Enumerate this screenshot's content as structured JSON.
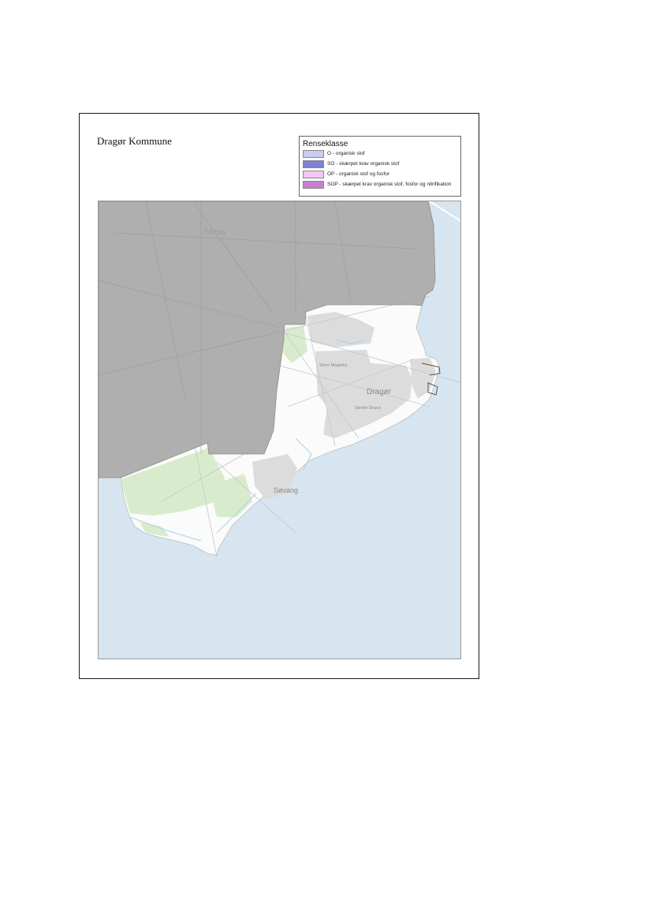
{
  "map": {
    "title": "Dragør Kommune",
    "legend": {
      "title": "Renseklasse",
      "items": [
        {
          "label": "O - organisk stof",
          "color": "#c8cbf2"
        },
        {
          "label": "SO - skærpet krav organisk stof",
          "color": "#7f7fd6"
        },
        {
          "label": "OP - organisk stof og fosfor",
          "color": "#f5c6f2"
        },
        {
          "label": "SOP - skærpet krav organisk stof, fosfor og nitrifikation",
          "color": "#c77fd1"
        }
      ]
    },
    "places": {
      "dragor": "Dragør",
      "store_magleby": "Store Magleby",
      "sondre_strand": "Søndre Strand",
      "savang": "Søvang",
      "tarnby": "Tårnby"
    },
    "colors": {
      "sea": "#d6e5f0",
      "outside_municipality": "#a9a9a9",
      "land": "#fbfbfb",
      "built_up": "#dcdcdc",
      "green": "#d8eccd",
      "water_lines": "#a8d4ea"
    }
  }
}
